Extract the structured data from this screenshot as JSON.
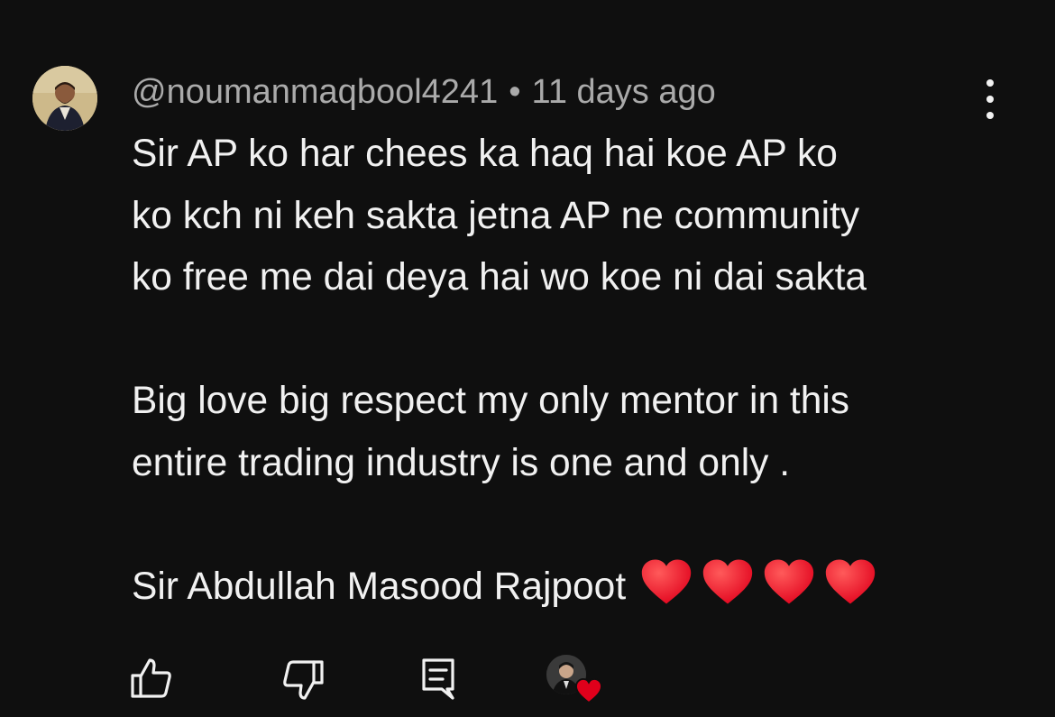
{
  "comment": {
    "author": "@noumanmaqbool4241",
    "separator": "•",
    "time": "11 days ago",
    "lines": [
      "Sir AP ko har chees ka haq hai koe AP ko",
      "ko kch ni keh sakta jetna AP ne community",
      "ko free me dai deya hai wo koe ni dai sakta",
      "",
      "Big love big respect my only mentor in this",
      "entire trading industry is one and  only .",
      "",
      "Sir Abdullah Masood Rajpoot"
    ],
    "heart_count": 4,
    "heart_color": "#e0001b"
  },
  "actions": {
    "like_icon": "thumbs-up-icon",
    "dislike_icon": "thumbs-down-icon",
    "reply_icon": "reply-icon",
    "creator_heart_icon": "creator-heart-icon"
  },
  "colors": {
    "background": "#0f0f0f",
    "text": "#f1f1f1",
    "meta": "#aaaaaa",
    "heart": "#e0001b"
  }
}
